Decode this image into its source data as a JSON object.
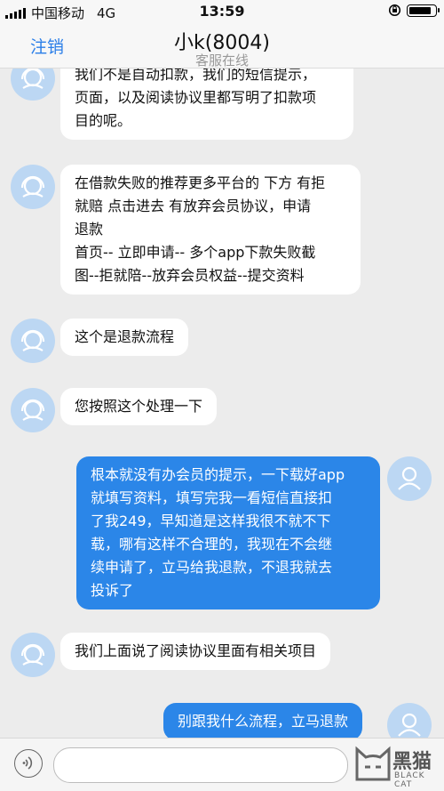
{
  "status_bar": {
    "carrier": "中国移动",
    "network": "4G",
    "time": "13:59",
    "battery_level": 0.9
  },
  "nav": {
    "back_label": "注销",
    "title": "小k(8004)",
    "subtitle": "客服在线"
  },
  "messages": [
    {
      "side": "in",
      "lines": [
        "我们不是自动扣款，我们的短信提示，",
        "页面，以及阅读协议里都写明了扣款项",
        "目的呢。"
      ]
    },
    {
      "side": "in",
      "lines": [
        "在借款失败的推荐更多平台的 下方 有拒",
        "就赔  点击进去  有放弃会员协议，申请",
        "退款",
        "首页-- 立即申请-- 多个app下款失败截",
        "图--拒就陪--放弃会员权益--提交资料"
      ]
    },
    {
      "side": "in",
      "lines": [
        "这个是退款流程"
      ]
    },
    {
      "side": "in",
      "lines": [
        "您按照这个处理一下"
      ]
    },
    {
      "side": "out",
      "lines": [
        "根本就没有办会员的提示，一下载好app",
        "就填写资料，填写完我一看短信直接扣",
        "了我249，早知道是这样我很不就不下",
        "载，哪有这样不合理的，我现在不会继",
        "续申请了，立马给我退款，不退我就去",
        "投诉了"
      ]
    },
    {
      "side": "in",
      "lines": [
        "我们上面说了阅读协议里面有相关项目"
      ]
    },
    {
      "side": "out",
      "lines": [
        "别跟我什么流程，立马退款"
      ]
    }
  ],
  "watermark": {
    "name": "黑猫",
    "brand": "BLACK CAT"
  },
  "colors": {
    "accent": "#2a7ee8",
    "outgoing_bubble": "#2b86e8",
    "avatar_bg": "#bcd7f3"
  }
}
